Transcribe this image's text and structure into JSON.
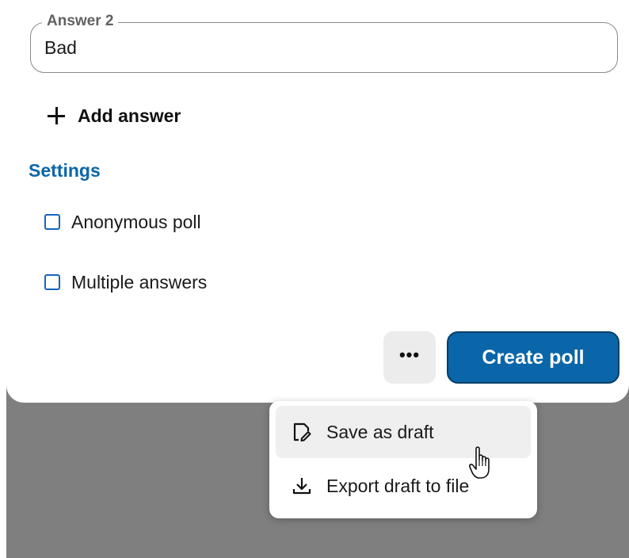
{
  "answer_field": {
    "legend": "Answer 2",
    "value": "Bad"
  },
  "add_answer": {
    "label": "Add answer",
    "icon": "plus-icon"
  },
  "settings": {
    "heading": "Settings",
    "options": [
      {
        "label": "Anonymous poll",
        "checked": false
      },
      {
        "label": "Multiple answers",
        "checked": false
      }
    ]
  },
  "footer": {
    "more_label": "•••",
    "create_label": "Create poll"
  },
  "menu": {
    "items": [
      {
        "label": "Save as draft",
        "icon": "save-draft-icon"
      },
      {
        "label": "Export draft to file",
        "icon": "download-icon"
      }
    ]
  },
  "colors": {
    "accent": "#0a66a8",
    "checkbox": "#1565c0",
    "overlay": "#7f7f7f"
  }
}
